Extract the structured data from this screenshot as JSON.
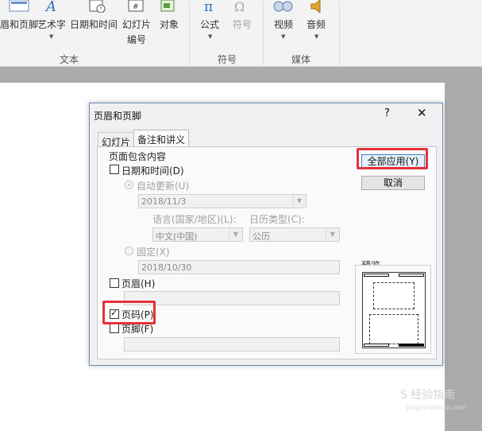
{
  "ribbon": {
    "buttons": [
      {
        "label": "眉和页脚",
        "name": "header-footer"
      },
      {
        "label": "艺术字",
        "name": "wordart"
      },
      {
        "label": "日期和时间",
        "name": "date-time"
      },
      {
        "label": "幻灯片",
        "label2": "编号",
        "name": "slide-number"
      },
      {
        "label": "对象",
        "name": "object"
      },
      {
        "label": "公式",
        "name": "equation"
      },
      {
        "label": "符号",
        "name": "symbol"
      },
      {
        "label": "视频",
        "name": "video"
      },
      {
        "label": "音频",
        "name": "audio"
      }
    ],
    "groups": {
      "text": "文本",
      "symbols": "符号",
      "media": "媒体"
    }
  },
  "dialog": {
    "title": "页眉和页脚",
    "help": "?",
    "close": "✕",
    "tabs": [
      "幻灯片",
      "备注和讲义"
    ],
    "active_tab": 1,
    "section_label": "页面包含内容",
    "date_time": {
      "label": "日期和时间(D)",
      "checked": false
    },
    "auto_update": {
      "label": "自动更新(U)",
      "selected": true,
      "value": "2018/11/3"
    },
    "language_label": "语言(国家/地区)(L):",
    "calendar_label": "日历类型(C):",
    "language_value": "中文(中国)",
    "calendar_value": "公历",
    "fixed": {
      "label": "固定(X)",
      "selected": false,
      "value": "2018/10/30"
    },
    "header": {
      "label": "页眉(H)",
      "checked": false,
      "value": ""
    },
    "page_number": {
      "label": "页码(P)",
      "checked": true
    },
    "footer": {
      "label": "页脚(F)",
      "checked": false,
      "value": ""
    },
    "apply_all": "全部应用(Y)",
    "cancel": "取消",
    "preview_label": "预览"
  },
  "watermark": {
    "text": "S 经验指南",
    "sub": "jingyanzhinan.com"
  },
  "colors": {
    "highlight": "#e8303a",
    "dialog_border": "#6b8db8"
  }
}
